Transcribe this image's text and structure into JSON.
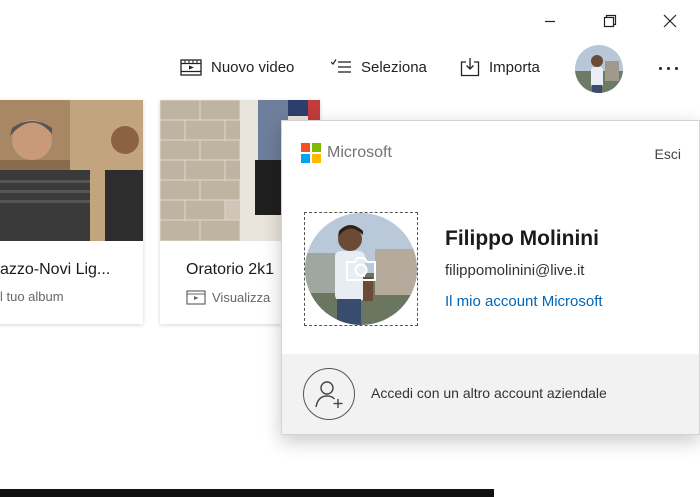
{
  "window": {
    "controls": [
      {
        "name": "minimize",
        "icon": "minimize-icon"
      },
      {
        "name": "restore",
        "icon": "restore-icon"
      },
      {
        "name": "close",
        "icon": "close-icon"
      }
    ]
  },
  "toolbar": {
    "new_video_label": "Nuovo video",
    "select_label": "Seleziona",
    "import_label": "Importa",
    "more_icon": "more-icon"
  },
  "albums": [
    {
      "title": "azzo-Novi Lig...",
      "subtitle": "l tuo album"
    },
    {
      "title": "Oratorio 2k1",
      "subtitle": "Visualizza"
    }
  ],
  "account_flyout": {
    "brand": "Microsoft",
    "brand_colors": [
      "#f25022",
      "#7fba00",
      "#00a4ef",
      "#ffb900"
    ],
    "sign_out_label": "Esci",
    "user_name": "Filippo Molinini",
    "user_email": "filippomolinini@live.it",
    "account_link_label": "Il mio account Microsoft",
    "add_account_label": "Accedi con un altro account aziendale"
  },
  "colors": {
    "link": "#0067b8",
    "footer_bg": "#f2f2f2"
  }
}
